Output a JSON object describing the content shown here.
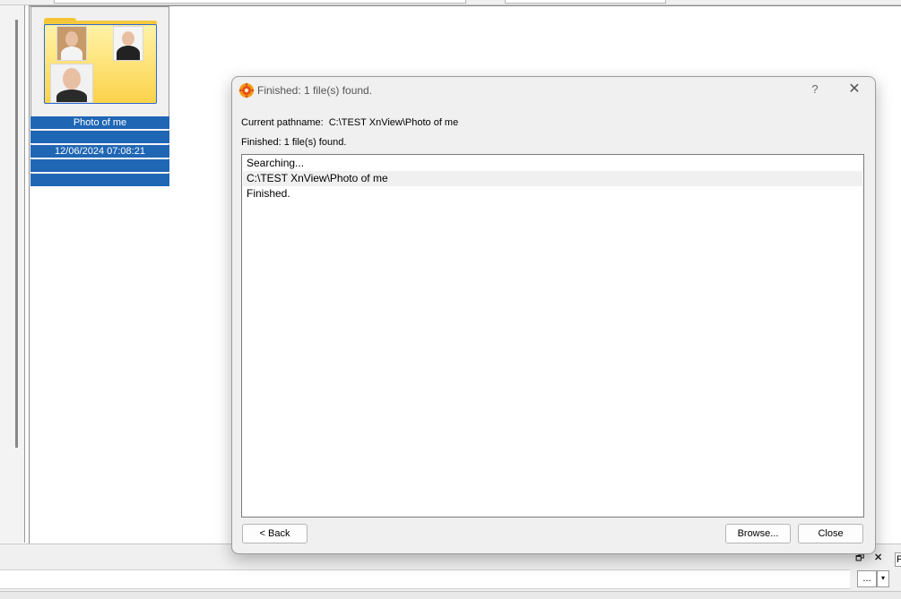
{
  "background": {
    "thumbnail": {
      "name": "Photo of me",
      "date": "12/06/2024 07:08:21",
      "folder_color": "#f5c73d",
      "selection_color": "#1f66b5"
    },
    "statusbar": {
      "restore_icon": "🗗",
      "close_icon": "✕",
      "more_label": "...",
      "dropdown_icon": "▾",
      "p_label": "P"
    }
  },
  "dialog": {
    "app_icon": "xnview-icon",
    "title": "Finished: 1 file(s) found.",
    "help_label": "?",
    "close_icon": "✕",
    "current_pathname_label": "Current pathname:",
    "current_pathname_value": "C:\\TEST XnView\\Photo of me",
    "status_text": "Finished: 1 file(s) found.",
    "log": [
      "Searching...",
      "C:\\TEST XnView\\Photo of me",
      "Finished."
    ],
    "buttons": {
      "back": "< Back",
      "browse": "Browse...",
      "close": "Close"
    }
  }
}
